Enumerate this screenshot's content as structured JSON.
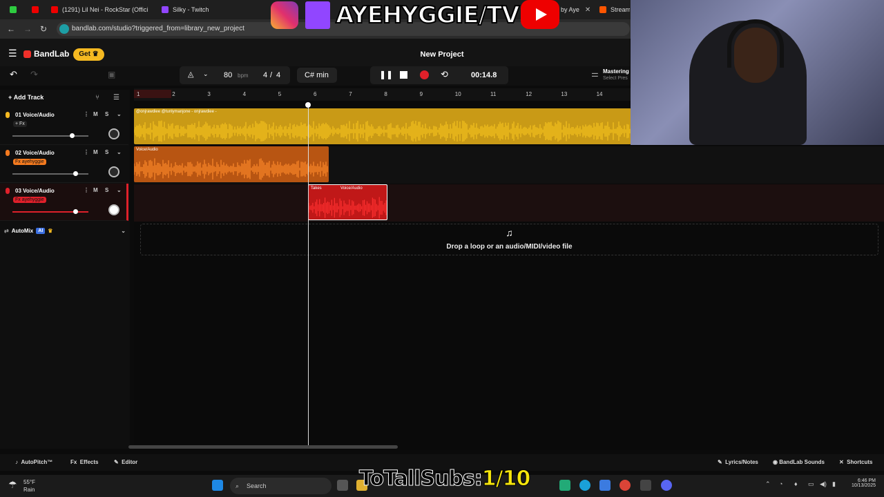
{
  "browser": {
    "tabs": [
      {
        "label": "",
        "color": "#2ecc40"
      },
      {
        "label": "",
        "color": "#e00"
      },
      {
        "label": "(1291) Lil Nei - RockStar (Offici",
        "color": "#e00"
      },
      {
        "label": "Silky - Twitch",
        "color": "#9146ff"
      },
      {
        "label": "by Aye",
        "color": "#e00"
      },
      {
        "label": "Stream",
        "color": "#ff5500"
      }
    ],
    "url": "bandlab.com/studio?triggered_from=library_new_project"
  },
  "overlay": {
    "brand": "AYEHYGGIE/TV"
  },
  "app": {
    "logo": "BandLab",
    "get_label": "Get",
    "project_title": "New Project",
    "tempo": "80",
    "tempo_unit": "bpm",
    "time_sig_num": "4",
    "time_sig_den": "4",
    "key": "C# min",
    "time": "00:14.8",
    "mastering": "Mastering",
    "mastering_sub": "Select Pres",
    "add_track": "Add Track"
  },
  "tracks": [
    {
      "name": "01  Voice/Audio",
      "fx": "+ Fx",
      "color": "#f5b921",
      "clip_label": "@onjrawdiee @tunlymanjone - onjrawdiee -",
      "volume": 0.8
    },
    {
      "name": "02  Voice/Audio",
      "fx": "Fx  ayehyggie",
      "color": "#f47a1f",
      "clip_label": "Voice/Audio",
      "volume": 0.85
    },
    {
      "name": "03  Voice/Audio",
      "fx": "Fx  ayehyggie",
      "color": "#e0202a",
      "clip_label": "Voice/Audio",
      "takes": "Takes",
      "volume": 0.85
    }
  ],
  "ms": {
    "m": "M",
    "s": "S"
  },
  "automix": {
    "label": "AutoMix",
    "badge": "AI"
  },
  "ruler": [
    "1",
    "2",
    "3",
    "4",
    "5",
    "6",
    "7",
    "8",
    "9",
    "10",
    "11",
    "12",
    "13",
    "14"
  ],
  "drop_zone": "Drop a loop or an audio/MIDI/video file",
  "bottom": {
    "autopitch": "AutoPitch™",
    "effects": "Effects",
    "editor": "Editor",
    "lyrics": "Lyrics/Notes",
    "sounds": "BandLab Sounds",
    "shortcuts": "Shortcuts"
  },
  "taskbar": {
    "temp": "55°F",
    "weather": "Rain",
    "search": "Search",
    "time": "6:46 PM",
    "date": "10/13/2025"
  },
  "subtitle": {
    "text": "ToTallSubs:",
    "score": "1/10"
  },
  "colors": {
    "accent": "#f5b921",
    "record": "#e0202a"
  }
}
